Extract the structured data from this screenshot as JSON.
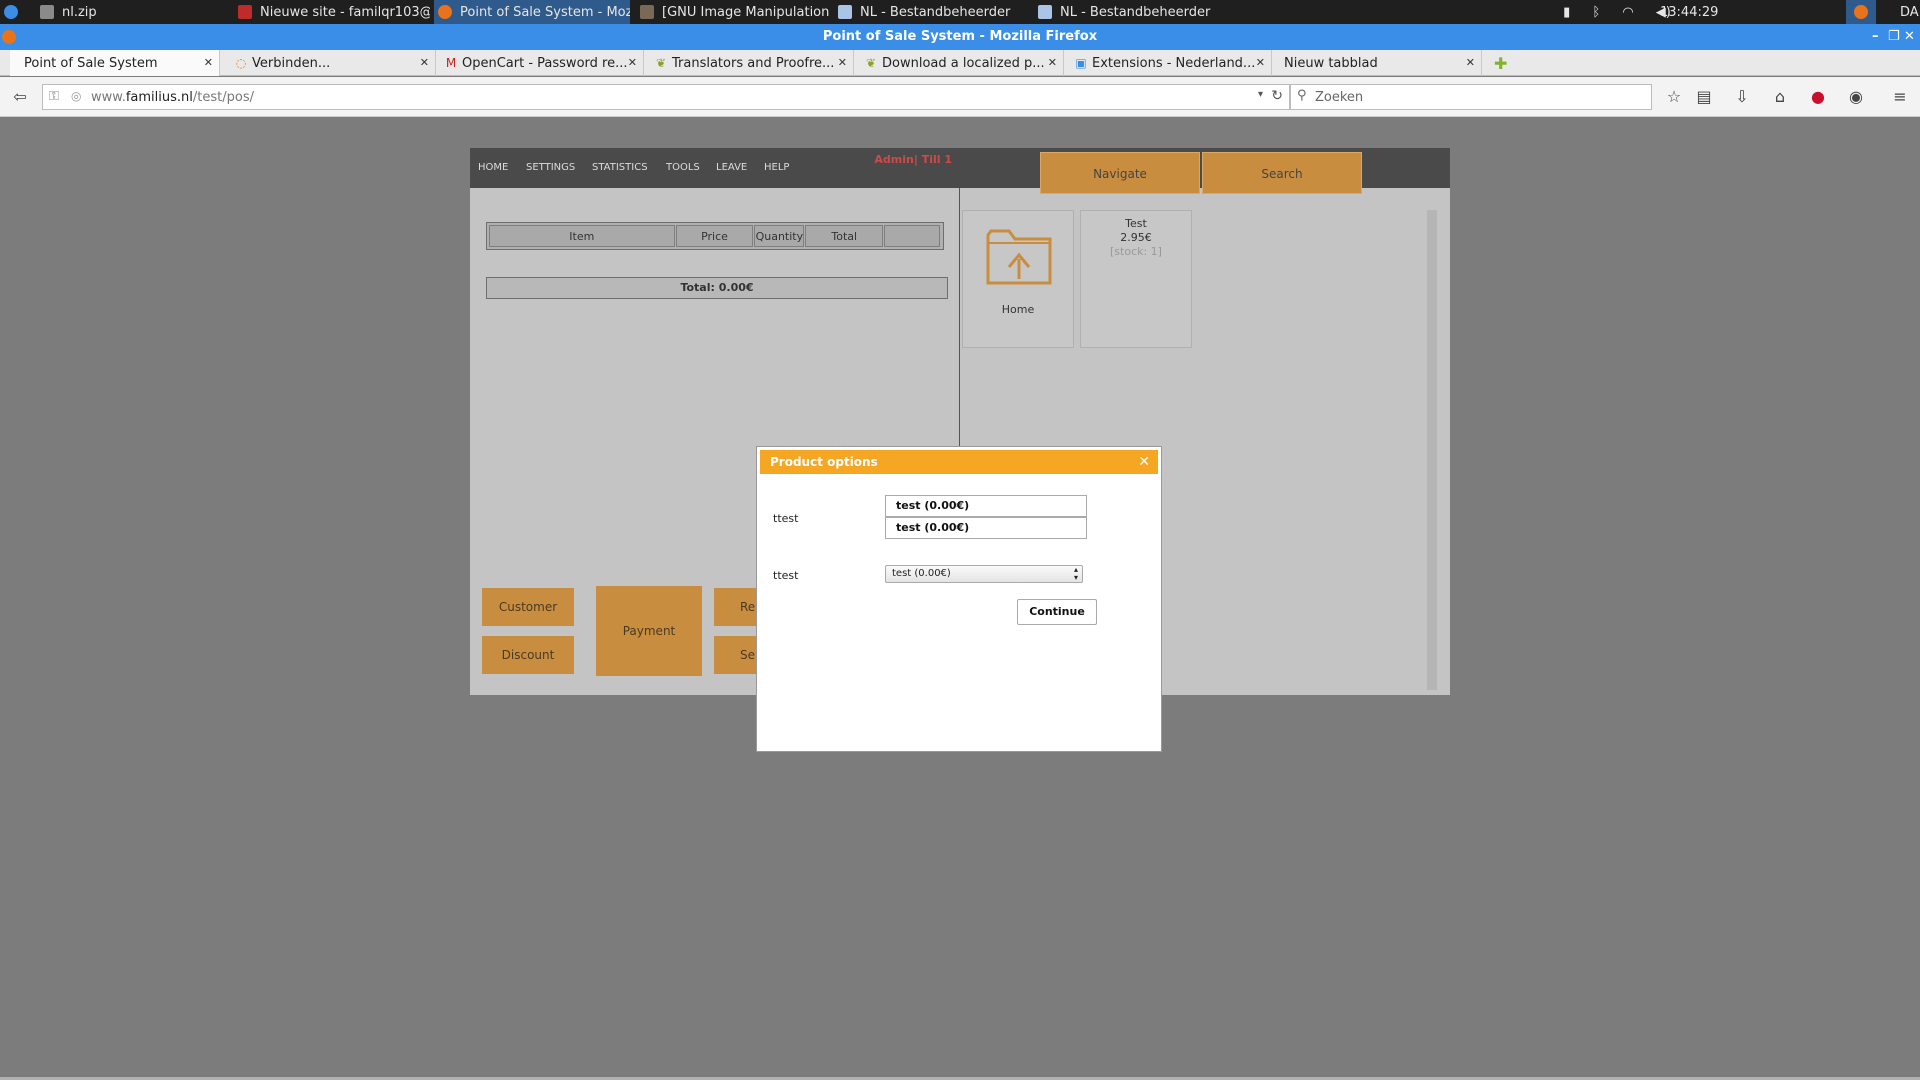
{
  "taskbar": {
    "items": [
      {
        "label": "nl.zip",
        "icon": "zip-icon"
      },
      {
        "label": "Nieuwe site - familqr103@...",
        "icon": "filezilla-icon"
      },
      {
        "label": "Point of Sale System - Moz...",
        "icon": "firefox-icon"
      },
      {
        "label": "[GNU Image Manipulation ...",
        "icon": "gimp-icon"
      },
      {
        "label": "NL - Bestandbeheerder",
        "icon": "folder-icon"
      },
      {
        "label": "NL - Bestandbeheerder",
        "icon": "folder-icon"
      }
    ],
    "clock": "13:44:29",
    "keyboard": "DA"
  },
  "window": {
    "title": "Point of Sale System - Mozilla Firefox"
  },
  "tabs": [
    {
      "label": "Point of Sale System",
      "active": true
    },
    {
      "label": "Verbinden..."
    },
    {
      "label": "OpenCart - Password re..."
    },
    {
      "label": "Translators and Proofre..."
    },
    {
      "label": "Download a localized p..."
    },
    {
      "label": "Extensions - Nederland..."
    },
    {
      "label": "Nieuw tabblad"
    }
  ],
  "navbar": {
    "url_prefix": "www.",
    "url_host": "familius.nl",
    "url_path": "/test/pos/",
    "search_placeholder": "Zoeken"
  },
  "pos": {
    "nav": [
      "HOME",
      "SETTINGS",
      "STATISTICS",
      "TOOLS",
      "LEAVE",
      "HELP"
    ],
    "admin_label": "Admin| Till 1",
    "right_tabs": [
      "Navigate",
      "Search"
    ],
    "columns": [
      "Item",
      "Price",
      "Quantity",
      "Total",
      ""
    ],
    "total_label": "Total: 0.00€",
    "buttons": {
      "customer": "Customer",
      "discount": "Discount",
      "payment": "Payment",
      "re": "Re",
      "se": "Se"
    },
    "tiles": [
      {
        "label": "Home",
        "icon": "folder-up-icon"
      },
      {
        "name": "Test",
        "price": "2.95€",
        "stock": "[stock: 1]"
      }
    ]
  },
  "modal": {
    "title": "Product options",
    "option1_label": "ttest",
    "option1_values": [
      "test (0.00€)",
      "test (0.00€)"
    ],
    "option2_label": "ttest",
    "option2_selected": "test (0.00€)",
    "continue": "Continue"
  },
  "colors": {
    "accent": "#f5a623",
    "pos_button": "#c98d3f",
    "admin_text": "#d14848",
    "titlebar": "#3a8ee8"
  }
}
